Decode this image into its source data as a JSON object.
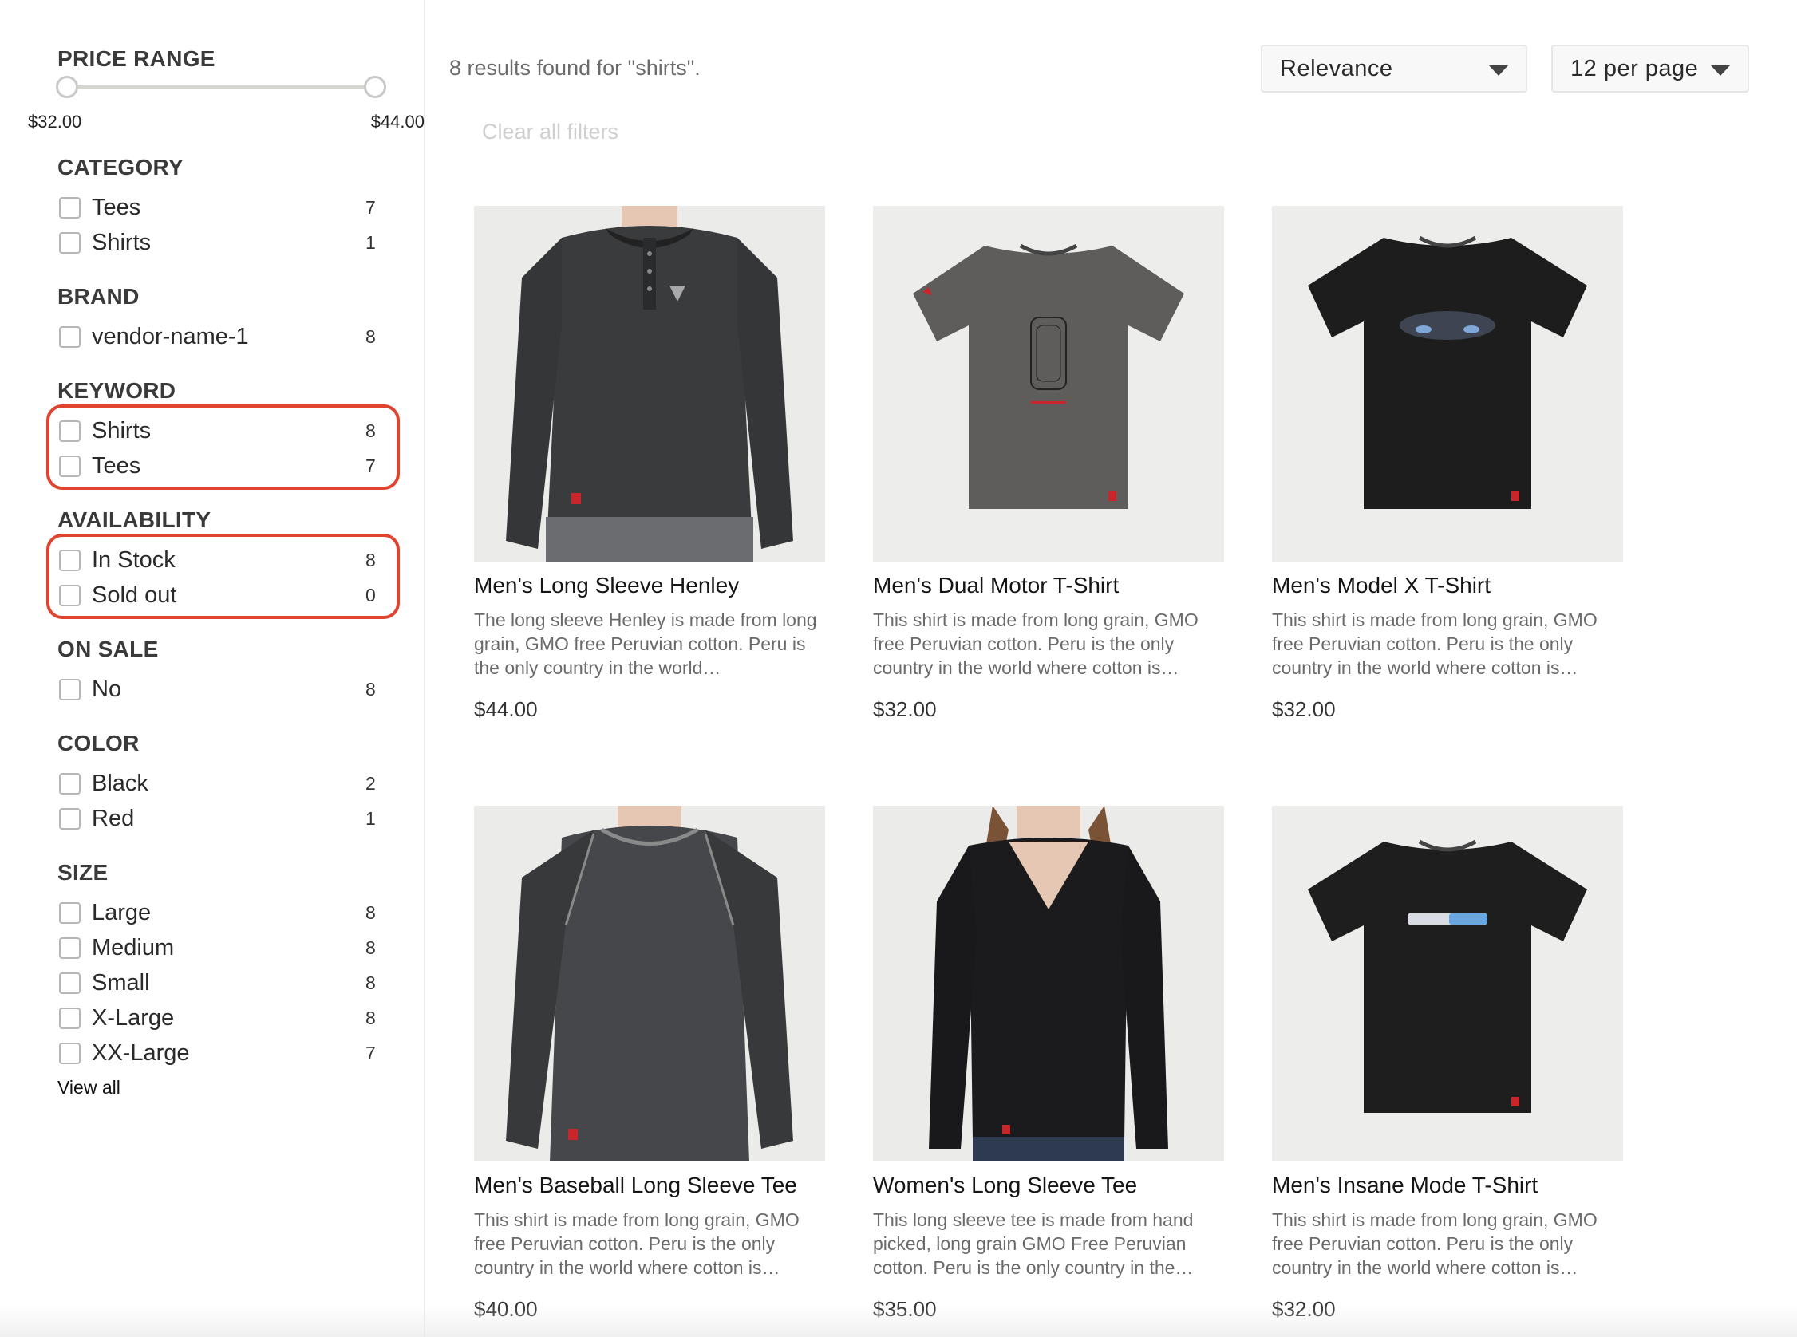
{
  "price_range": {
    "title": "PRICE RANGE",
    "min_label": "$32.00",
    "max_label": "$44.00",
    "slider_min": 32.0,
    "slider_max": 44.0
  },
  "facets": {
    "category": {
      "title": "CATEGORY",
      "items": [
        {
          "label": "Tees",
          "count": "7"
        },
        {
          "label": "Shirts",
          "count": "1"
        }
      ]
    },
    "brand": {
      "title": "BRAND",
      "items": [
        {
          "label": "vendor-name-1",
          "count": "8"
        }
      ]
    },
    "keyword": {
      "title": "KEYWORD",
      "items": [
        {
          "label": "Shirts",
          "count": "8"
        },
        {
          "label": "Tees",
          "count": "7"
        }
      ]
    },
    "availability": {
      "title": "AVAILABILITY",
      "items": [
        {
          "label": "In Stock",
          "count": "8"
        },
        {
          "label": "Sold out",
          "count": "0"
        }
      ]
    },
    "on_sale": {
      "title": "ON SALE",
      "items": [
        {
          "label": "No",
          "count": "8"
        }
      ]
    },
    "color": {
      "title": "COLOR",
      "items": [
        {
          "label": "Black",
          "count": "2"
        },
        {
          "label": "Red",
          "count": "1"
        }
      ]
    },
    "size": {
      "title": "SIZE",
      "items": [
        {
          "label": "Large",
          "count": "8"
        },
        {
          "label": "Medium",
          "count": "8"
        },
        {
          "label": "Small",
          "count": "8"
        },
        {
          "label": "X-Large",
          "count": "8"
        },
        {
          "label": "XX-Large",
          "count": "7"
        }
      ]
    },
    "view_all": "View all"
  },
  "toolbar": {
    "results_text": "8 results found for \"shirts\".",
    "clear_filters": "Clear all filters",
    "sort_value": "Relevance",
    "per_page_value": "12 per page"
  },
  "products": [
    {
      "name": "Men's Long Sleeve Henley",
      "description": "The long sleeve Henley is made from long grain, GMO free Peruvian cotton. Peru is the only country in the world…",
      "price": "$44.00"
    },
    {
      "name": "Men's Dual Motor T-Shirt",
      "description": "This shirt is made from long grain, GMO free Peruvian cotton. Peru is the only country in the world where cotton is…",
      "price": "$32.00"
    },
    {
      "name": "Men's Model X T-Shirt",
      "description": "This shirt is made from long grain, GMO free Peruvian cotton. Peru is the only country in the world where cotton is…",
      "price": "$32.00"
    },
    {
      "name": "Men's Baseball Long Sleeve Tee",
      "description": "This shirt is made from long grain, GMO free Peruvian cotton. Peru is the only country in the world where cotton is…",
      "price": "$40.00"
    },
    {
      "name": "Women's Long Sleeve Tee",
      "description": "This long sleeve tee is made from hand picked, long grain GMO Free Peruvian cotton. Peru is the only country in the…",
      "price": "$35.00"
    },
    {
      "name": "Men's Insane Mode T-Shirt",
      "description": "This shirt is made from long grain, GMO free Peruvian cotton. Peru is the only country in the world where cotton is…",
      "price": "$32.00"
    }
  ],
  "colors": {
    "highlight": "#e0432f",
    "tee_charcoal": "#3a3b3d",
    "tee_grey": "#5e5d5c",
    "tee_black": "#1e1d1d",
    "tag_red": "#c8262b"
  }
}
